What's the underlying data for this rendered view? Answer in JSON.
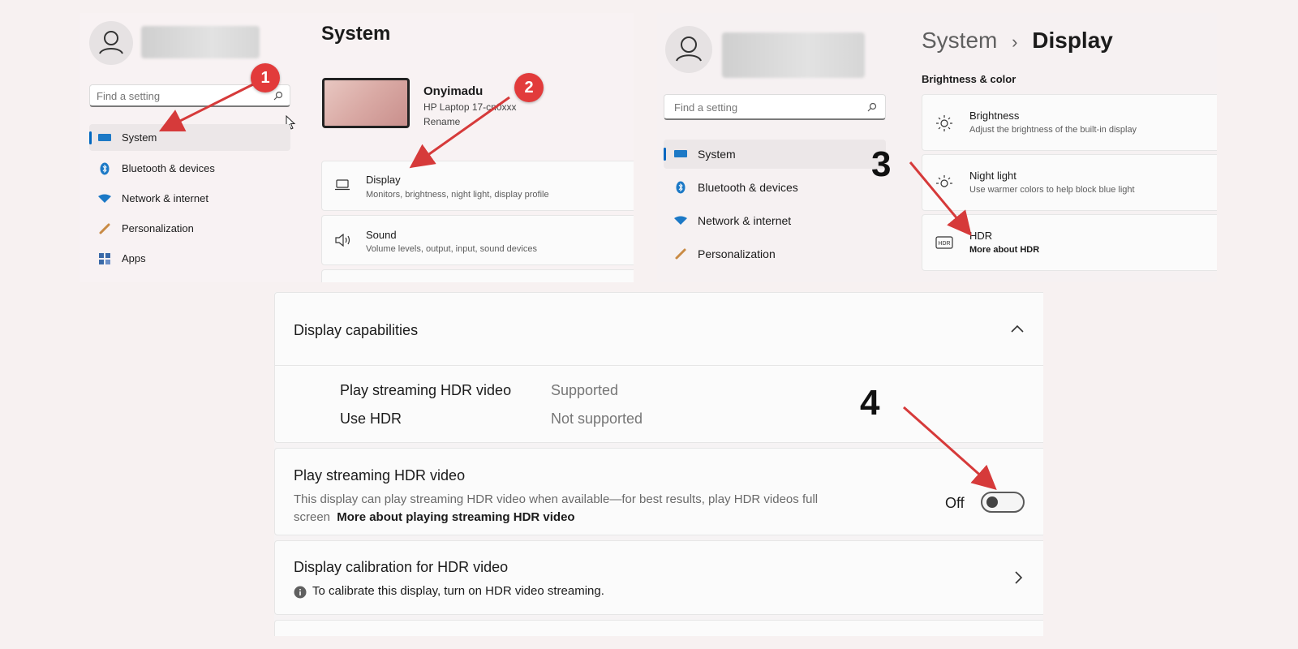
{
  "panel1": {
    "title": "System",
    "search_placeholder": "Find a setting",
    "nav": [
      "System",
      "Bluetooth & devices",
      "Network & internet",
      "Personalization",
      "Apps"
    ],
    "device": {
      "name": "Onyimadu",
      "model": "HP Laptop 17-cn0xxx",
      "rename": "Rename"
    },
    "cards": [
      {
        "title": "Display",
        "desc": "Monitors, brightness, night light, display profile"
      },
      {
        "title": "Sound",
        "desc": "Volume levels, output, input, sound devices"
      }
    ]
  },
  "panel2": {
    "breadcrumb_parent": "System",
    "breadcrumb_sep": "›",
    "breadcrumb_current": "Display",
    "section": "Brightness & color",
    "search_placeholder": "Find a setting",
    "nav": [
      "System",
      "Bluetooth & devices",
      "Network & internet",
      "Personalization"
    ],
    "cards": [
      {
        "title": "Brightness",
        "desc": "Adjust the brightness of the built-in display"
      },
      {
        "title": "Night light",
        "desc": "Use warmer colors to help block blue light"
      },
      {
        "title": "HDR",
        "desc": "More about HDR"
      }
    ]
  },
  "panel3": {
    "capabilities_title": "Display capabilities",
    "capabilities": [
      {
        "label": "Play streaming HDR video",
        "value": "Supported"
      },
      {
        "label": "Use HDR",
        "value": "Not supported"
      }
    ],
    "streaming": {
      "title": "Play streaming HDR video",
      "desc": "This display can play streaming HDR video when available—for best results, play HDR videos full screen",
      "link": "More about playing streaming HDR video",
      "toggle_label": "Off"
    },
    "calibration": {
      "title": "Display calibration for HDR video",
      "info": "To calibrate this display, turn on HDR video streaming."
    }
  },
  "steps": [
    "1",
    "2",
    "3",
    "4"
  ],
  "colors": {
    "accent": "#0067c0",
    "badge": "#e23b3b",
    "arrow": "#d63a3a"
  }
}
